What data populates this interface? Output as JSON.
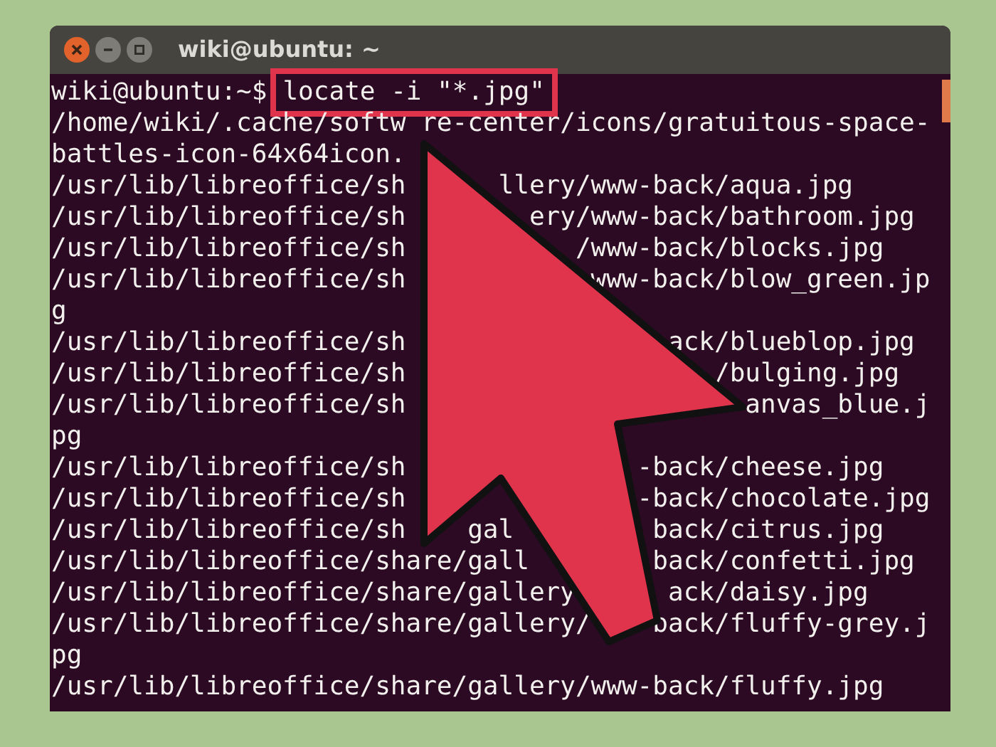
{
  "window": {
    "title": "wiki@ubuntu: ~",
    "buttons": [
      {
        "kind": "close"
      },
      {
        "kind": "minimize"
      },
      {
        "kind": "maximize"
      }
    ]
  },
  "terminal": {
    "prompt": "wiki@ubuntu:~$",
    "command": "locate -i \"*.jpg\"",
    "command_highlighted": true,
    "output": [
      "/home/wiki/.cache/softw re-center/icons/gratuitous-space-",
      "battles-icon-64x64icon.",
      "/usr/lib/libreoffice/sh      llery/www-back/aqua.jpg",
      "/usr/lib/libreoffice/sh        ery/www-back/bathroom.jpg",
      "/usr/lib/libreoffice/sh           /www-back/blocks.jpg",
      "/usr/lib/libreoffice/sh            www-back/blow_green.jp",
      "g",
      "/usr/lib/libreoffice/sh                 ack/blueblop.jpg",
      "/usr/lib/libreoffice/sh                    /bulging.jpg",
      "/usr/lib/libreoffice/sh                      anvas_blue.j",
      "pg",
      "/usr/lib/libreoffice/sh               -back/cheese.jpg",
      "/usr/lib/libreoffice/sh               -back/chocolate.jpg",
      "/usr/lib/libreoffice/sh    gal         back/citrus.jpg",
      "/usr/lib/libreoffice/share/gall        back/confetti.jpg",
      "/usr/lib/libreoffice/share/gallery      ack/daisy.jpg",
      "/usr/lib/libreoffice/share/gallery/    back/fluffy-grey.j",
      "pg",
      "/usr/lib/libreoffice/share/gallery/www-back/fluffy.jpg"
    ]
  }
}
